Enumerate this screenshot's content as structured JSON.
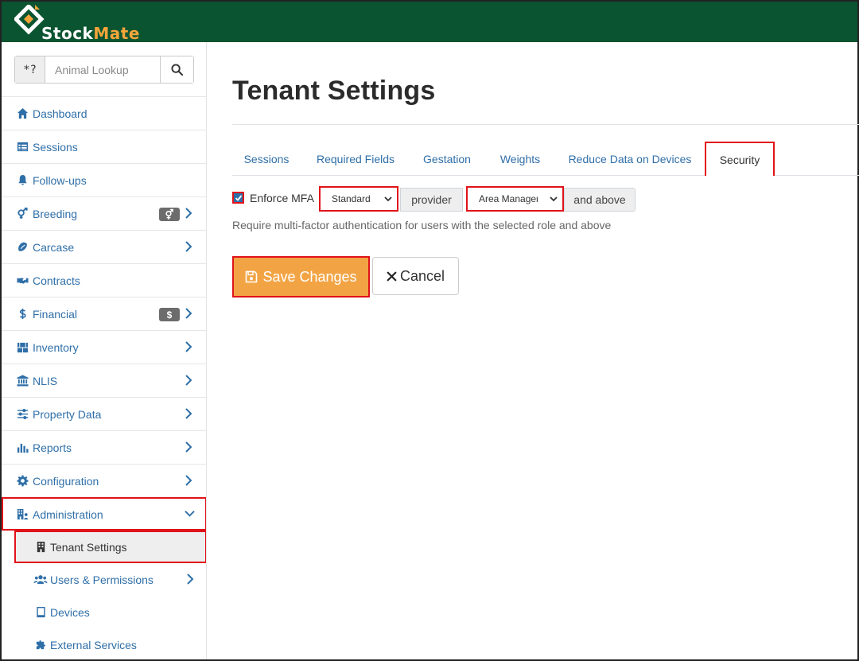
{
  "app": {
    "logo_text_main": "Stock",
    "logo_text_accent": "Mate",
    "brand_color": "#0b5431",
    "accent_color": "#f4a53a",
    "highlight_color": "#e0121a"
  },
  "search": {
    "prefix": "*?",
    "placeholder": "Animal Lookup",
    "value": "",
    "icon": "search-icon"
  },
  "sidebar": {
    "items": [
      {
        "label": "Dashboard",
        "icon": "home-icon"
      },
      {
        "label": "Sessions",
        "icon": "table-icon"
      },
      {
        "label": "Follow-ups",
        "icon": "bell-icon"
      },
      {
        "label": "Breeding",
        "icon": "gender-icon",
        "badge": "⚥"
      },
      {
        "label": "Carcase",
        "icon": "carcase-icon"
      },
      {
        "label": "Contracts",
        "icon": "handshake-icon"
      },
      {
        "label": "Financial",
        "icon": "dollar-icon",
        "badge": "$"
      },
      {
        "label": "Inventory",
        "icon": "boxes-icon"
      },
      {
        "label": "NLIS",
        "icon": "bank-icon"
      },
      {
        "label": "Property Data",
        "icon": "sliders-icon"
      },
      {
        "label": "Reports",
        "icon": "bar-chart-icon"
      },
      {
        "label": "Configuration",
        "icon": "cog-icon"
      },
      {
        "label": "Administration",
        "icon": "building-user-icon"
      }
    ],
    "sub_items": [
      {
        "label": "Tenant Settings",
        "icon": "building-icon"
      },
      {
        "label": "Users & Permissions",
        "icon": "users-icon"
      },
      {
        "label": "Devices",
        "icon": "tablet-icon"
      },
      {
        "label": "External Services",
        "icon": "puzzle-icon"
      }
    ]
  },
  "main": {
    "title": "Tenant Settings",
    "tabs": [
      {
        "label": "Sessions"
      },
      {
        "label": "Required Fields"
      },
      {
        "label": "Gestation"
      },
      {
        "label": "Weights"
      },
      {
        "label": "Reduce Data on Devices"
      },
      {
        "label": "Security",
        "active": true
      }
    ],
    "mfa": {
      "checked": true,
      "label": "Enforce MFA",
      "provider_select": "Standard",
      "provider_addon": "provider",
      "role_select": "Area Manager",
      "role_addon": "and above",
      "help": "Require multi-factor authentication for users with the selected role and above"
    },
    "actions": {
      "save_label": "Save Changes",
      "cancel_label": "Cancel"
    }
  }
}
